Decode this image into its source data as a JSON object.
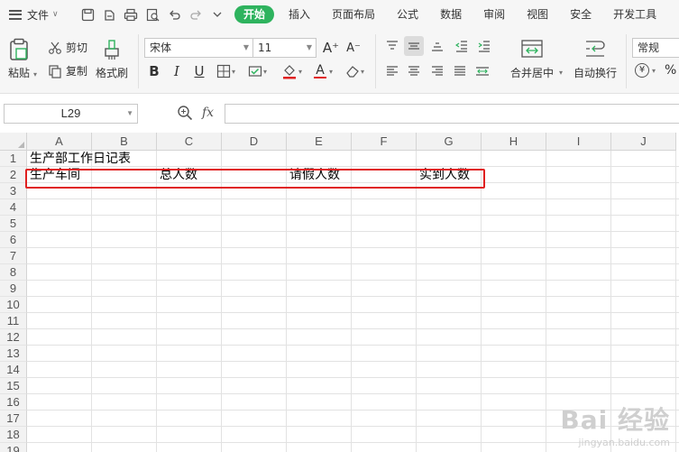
{
  "menubar": {
    "file_label": "文件",
    "tabs": [
      "开始",
      "插入",
      "页面布局",
      "公式",
      "数据",
      "审阅",
      "视图",
      "安全",
      "开发工具"
    ],
    "active_tab": "开始"
  },
  "ribbon": {
    "paste_label": "粘贴",
    "cut_label": "剪切",
    "copy_label": "复制",
    "format_painter_label": "格式刷",
    "font_name": "宋体",
    "font_size": "11",
    "bold": "B",
    "italic": "I",
    "underline": "U",
    "merge_center_label": "合并居中",
    "wrap_text_label": "自动换行",
    "number_format": "常规",
    "currency_symbol": "¥",
    "percent_symbol": "%",
    "font_color": "#e02020",
    "brand_green": "#2eb35e"
  },
  "formula_bar": {
    "cell_ref": "L29",
    "fx_label": "fx",
    "formula_value": ""
  },
  "sheet": {
    "columns": [
      "A",
      "B",
      "C",
      "D",
      "E",
      "F",
      "G",
      "H",
      "I",
      "J"
    ],
    "rows": [
      "1",
      "2",
      "3",
      "4",
      "5",
      "6",
      "7",
      "8",
      "9",
      "10",
      "11",
      "12",
      "13",
      "14",
      "15",
      "16",
      "17",
      "18",
      "19"
    ],
    "cells": {
      "A1": "生产部工作日记表",
      "A2": "生产车间",
      "C2": "总人数",
      "E2": "请假人数",
      "G2": "实到人数"
    },
    "highlight_color": "#e02020"
  },
  "watermark": {
    "main": "Bai 经验",
    "sub": "jingyan.baidu.com"
  }
}
